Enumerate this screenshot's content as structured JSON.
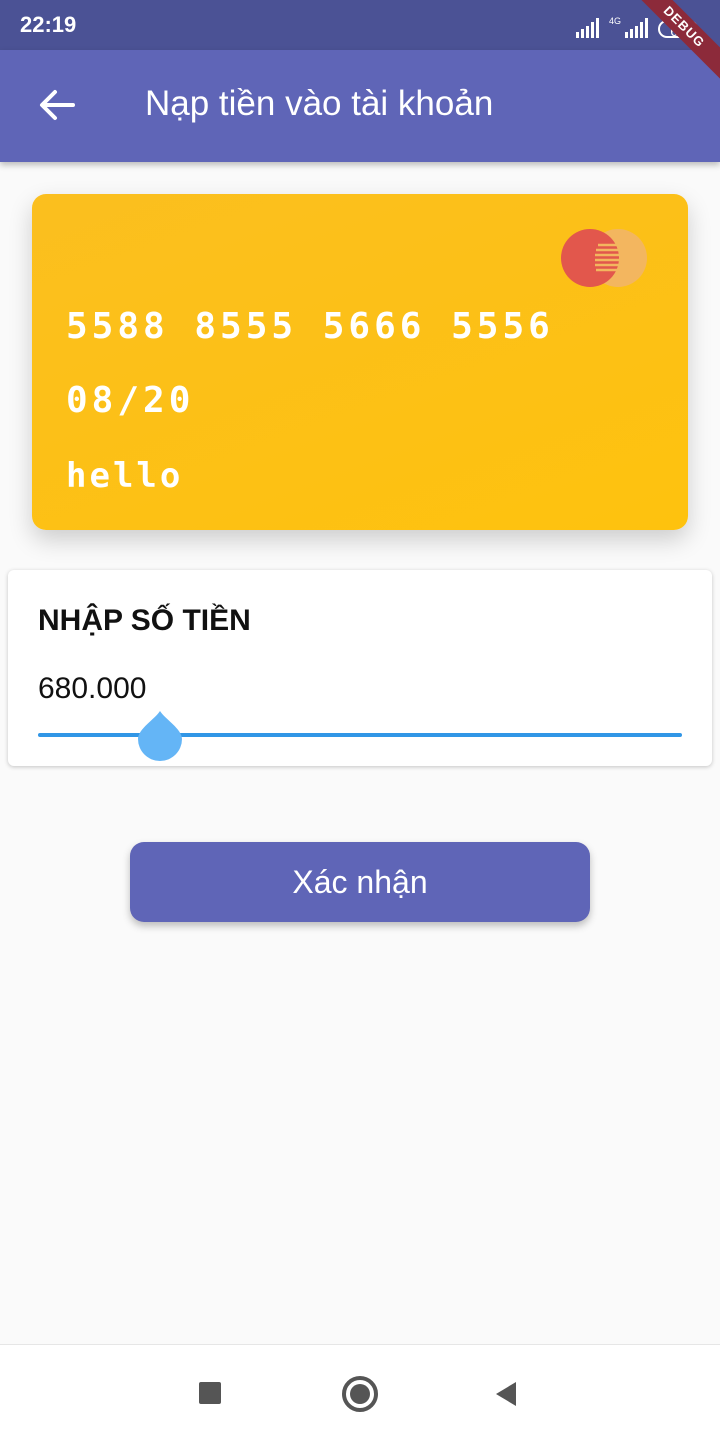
{
  "status_bar": {
    "time": "22:19",
    "network_label": "4G",
    "battery": "62"
  },
  "debug_banner": "DEBUG",
  "app_bar": {
    "title": "Nạp tiền vào tài khoản",
    "back_icon": "arrow-left-icon"
  },
  "card": {
    "number": "5588 8555 5666 5556",
    "expiry": "08/20",
    "holder": "hello",
    "brand_icon": "mastercard-logo",
    "colors": {
      "background": "#fec20e",
      "logo_left": "#e2574c",
      "logo_right": "#f3b65f"
    }
  },
  "amount_panel": {
    "heading": "NHẬP SỐ TIỀN",
    "value": "680.000",
    "slider_level": 0.19
  },
  "confirm_button": {
    "label": "Xác nhận"
  },
  "nav_bar": {
    "icons": [
      "recent-apps-icon",
      "home-icon",
      "back-icon"
    ]
  },
  "colors": {
    "primary": "#5f65b7",
    "status_bar": "#4b5295",
    "slider": "#3196e6",
    "slider_thumb": "#64b5f6"
  }
}
